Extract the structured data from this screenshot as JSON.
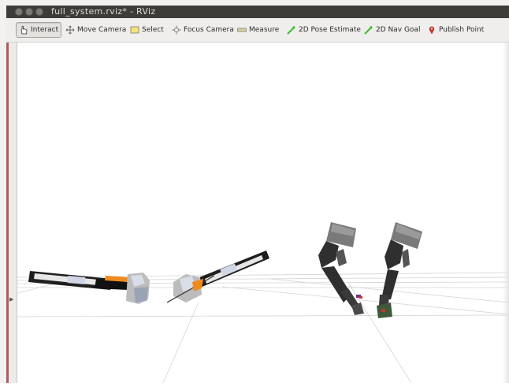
{
  "window": {
    "title": "full_system.rviz* - RViz"
  },
  "toolbar": {
    "tools": [
      {
        "label": "Interact",
        "icon": "hand-pointer-icon",
        "active": true
      },
      {
        "label": "Move Camera",
        "icon": "move-arrows-icon",
        "active": false
      },
      {
        "label": "Select",
        "icon": "select-rectangle-icon",
        "active": false
      },
      {
        "label": "Focus Camera",
        "icon": "focus-crosshair-icon",
        "active": false
      },
      {
        "label": "Measure",
        "icon": "ruler-icon",
        "active": false
      },
      {
        "label": "2D Pose Estimate",
        "icon": "green-arrow-icon",
        "active": false
      },
      {
        "label": "2D Nav Goal",
        "icon": "green-arrow-icon",
        "active": false
      },
      {
        "label": "Publish Point",
        "icon": "map-pin-icon",
        "active": false
      }
    ]
  },
  "colors": {
    "titlebar": "#3d3c39",
    "toolbar": "#efeeec",
    "viewport_background": "#ffffff",
    "grid": "#cfcfcf",
    "pose_arrow": "#3dbb2a",
    "publish_pin": "#c0392b",
    "gripper_accent": "#f08a1e",
    "robot_body": "#2f2f2f",
    "robot_head": "#bcbcbc",
    "arm_joint": "#cfd6e6"
  }
}
